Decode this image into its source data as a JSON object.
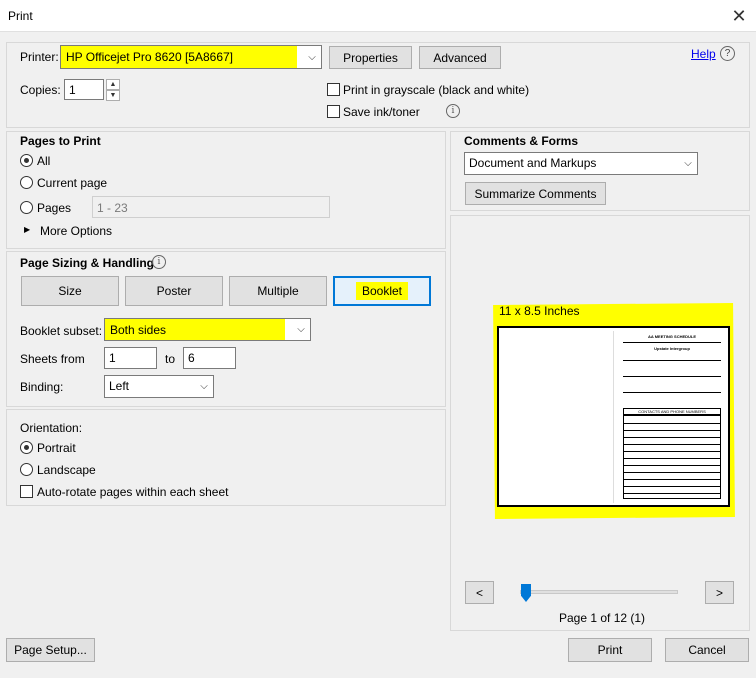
{
  "window": {
    "title": "Print",
    "close_glyph": "✕"
  },
  "printer": {
    "label": "Printer:",
    "selected": "HP Officejet Pro 8620 [5A8667]",
    "properties_label": "Properties",
    "advanced_label": "Advanced",
    "help_label": "Help"
  },
  "copies": {
    "label": "Copies:",
    "value": "1"
  },
  "options": {
    "grayscale_label": "Print in grayscale (black and white)",
    "save_ink_label": "Save ink/toner"
  },
  "pages_to_print": {
    "heading": "Pages to Print",
    "all_label": "All",
    "current_label": "Current page",
    "pages_label": "Pages",
    "pages_value": "1 - 23",
    "more_options_label": "More Options"
  },
  "sizing": {
    "heading": "Page Sizing & Handling",
    "buttons": [
      "Size",
      "Poster",
      "Multiple",
      "Booklet"
    ],
    "active": "Booklet",
    "booklet_subset_label": "Booklet subset:",
    "booklet_subset_value": "Both sides",
    "sheets_from_label": "Sheets from",
    "sheets_from_value": "1",
    "to_label": "to",
    "sheets_to_value": "6",
    "binding_label": "Binding:",
    "binding_value": "Left"
  },
  "orientation": {
    "heading": "Orientation:",
    "portrait_label": "Portrait",
    "landscape_label": "Landscape",
    "autorotate_label": "Auto-rotate pages within each sheet"
  },
  "comments": {
    "heading": "Comments & Forms",
    "selected": "Document and Markups",
    "summarize_label": "Summarize Comments"
  },
  "preview": {
    "size_label": "11 x 8.5 Inches",
    "doc_title": "AA MEETING SCHEDULE",
    "doc_subtitle": "Upstate Intergroup",
    "doc_section": "CONTACTS AND PHONE NUMBERS",
    "prev_label": "<",
    "next_label": ">",
    "page_status": "Page 1 of 12 (1)",
    "slider_fraction": 0.0
  },
  "footer": {
    "page_setup_label": "Page Setup...",
    "print_label": "Print",
    "cancel_label": "Cancel"
  },
  "colors": {
    "highlight": "#ffff00",
    "active_border": "#0078d7",
    "slider": "#0078d7"
  }
}
